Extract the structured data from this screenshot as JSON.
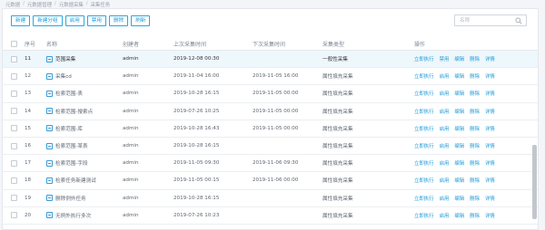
{
  "breadcrumb": [
    "元数据",
    "元数据管理",
    "元数据采集",
    "采集任务"
  ],
  "toolbar": {
    "buttons": [
      "新建",
      "新建分组",
      "启用",
      "禁用",
      "删除",
      "刷新"
    ]
  },
  "search": {
    "placeholder": "名称",
    "icon": "search-icon"
  },
  "table": {
    "headers": {
      "no": "序号",
      "name": "名称",
      "creator": "创建者",
      "last_run": "上次采集时间",
      "next_run": "下次采集时间",
      "type": "采集类型",
      "ops": "操作"
    },
    "rows": [
      {
        "no": "11",
        "name": "范围采集",
        "creator": "admin",
        "last_run": "2019-12-08 00:30",
        "next_run": "",
        "type": "一般性采集",
        "actions": [
          "立即执行",
          "禁用",
          "编辑",
          "删除",
          "详情"
        ],
        "selected": true
      },
      {
        "no": "12",
        "name": "采集cd",
        "creator": "admin",
        "last_run": "2019-11-04 16:00",
        "next_run": "2019-11-05 16:00",
        "type": "属性填充采集",
        "actions": [
          "立即执行",
          "启用",
          "编辑",
          "删除",
          "详情"
        ]
      },
      {
        "no": "13",
        "name": "检索范围-表",
        "creator": "admin",
        "last_run": "2019-10-28 16:15",
        "next_run": "2019-11-05 00:00",
        "type": "属性填充采集",
        "actions": [
          "立即执行",
          "启用",
          "编辑",
          "删除",
          "详情"
        ]
      },
      {
        "no": "14",
        "name": "检索范围-搜索点",
        "creator": "admin",
        "last_run": "2019-07-26 10:25",
        "next_run": "2019-11-05 00:00",
        "type": "属性填充采集",
        "actions": [
          "立即执行",
          "启用",
          "编辑",
          "删除",
          "详情"
        ]
      },
      {
        "no": "15",
        "name": "检索范围-库",
        "creator": "admin",
        "last_run": "2019-10-28 16:43",
        "next_run": "2019-11-05 00:00",
        "type": "属性填充采集",
        "actions": [
          "立即执行",
          "启用",
          "编辑",
          "删除",
          "详情"
        ]
      },
      {
        "no": "16",
        "name": "检索范围-某表",
        "creator": "admin",
        "last_run": "2019-10-28 16:15",
        "next_run": "",
        "type": "属性填充采集",
        "actions": [
          "立即执行",
          "启用",
          "编辑",
          "删除",
          "详情"
        ]
      },
      {
        "no": "17",
        "name": "检索范围-字段",
        "creator": "admin",
        "last_run": "2019-11-05 09:30",
        "next_run": "2019-11-06 09:30",
        "type": "属性填充采集",
        "actions": [
          "立即执行",
          "启用",
          "编辑",
          "删除",
          "详情"
        ]
      },
      {
        "no": "18",
        "name": "检索任务新建测试",
        "creator": "admin",
        "last_run": "2019-11-05 00:15",
        "next_run": "2019-11-06 00:00",
        "type": "属性填充采集",
        "actions": [
          "立即执行",
          "启用",
          "编辑",
          "删除",
          "详情"
        ]
      },
      {
        "no": "19",
        "name": "删除例外任务",
        "creator": "admin",
        "last_run": "2019-10-28 16:15",
        "next_run": "",
        "type": "属性填充采集",
        "actions": [
          "立即执行",
          "启用",
          "编辑",
          "删除",
          "详情"
        ]
      },
      {
        "no": "20",
        "name": "无例外执行多次",
        "creator": "admin",
        "last_run": "2019-07-26 10:23",
        "next_run": "",
        "type": "属性填充采集",
        "actions": [
          "立即执行",
          "启用",
          "编辑",
          "删除",
          "详情"
        ]
      }
    ]
  },
  "colors": {
    "accent": "#1d9bd8",
    "selected_row": "#eef7fb"
  }
}
